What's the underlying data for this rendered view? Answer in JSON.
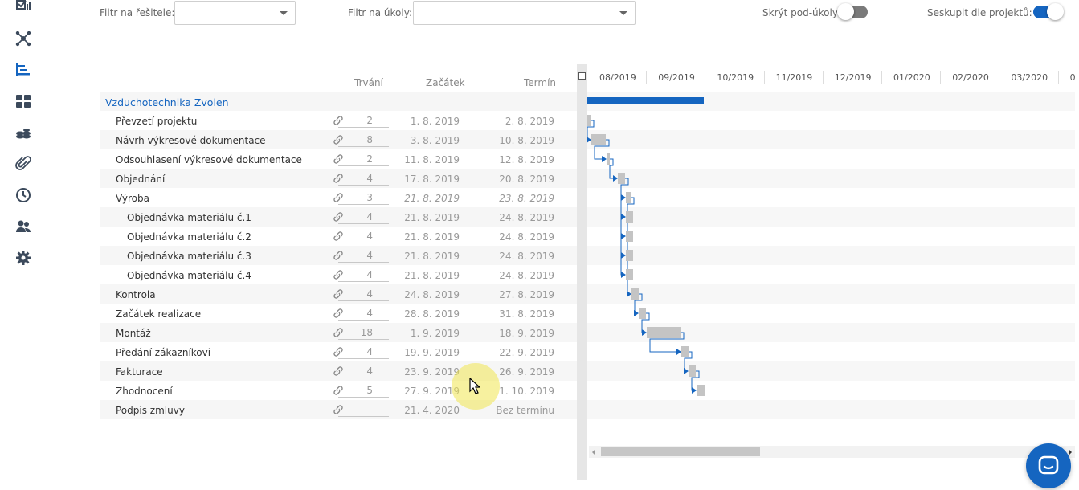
{
  "filters": {
    "assignee_label": "Filtr na řešitele:",
    "task_label": "Filtr na úkoly:",
    "hide_subtasks_label": "Skrýt pod-úkoly:",
    "hide_subtasks_on": false,
    "group_by_project_label": "Seskupit dle projektů:",
    "group_by_project_on": true
  },
  "table": {
    "headers": {
      "duration": "Trvání",
      "start": "Začátek",
      "end": "Termín"
    },
    "rows": [
      {
        "name": "Vzduchotechnika Zvolen",
        "type": "project",
        "duration": "",
        "start": "",
        "end": ""
      },
      {
        "name": "Převzetí projektu",
        "type": "task",
        "duration": "2",
        "start": "1. 8. 2019",
        "end": "2. 8. 2019"
      },
      {
        "name": "Návrh výkresové dokumentace",
        "type": "task",
        "duration": "8",
        "start": "3. 8. 2019",
        "end": "10. 8. 2019"
      },
      {
        "name": "Odsouhlasení výkresové dokumentace",
        "type": "task",
        "duration": "2",
        "start": "11. 8. 2019",
        "end": "12. 8. 2019"
      },
      {
        "name": "Objednání",
        "type": "task",
        "duration": "4",
        "start": "17. 8. 2019",
        "end": "20. 8. 2019"
      },
      {
        "name": "Výroba",
        "type": "parent",
        "duration": "3",
        "start": "21. 8. 2019",
        "end": "23. 8. 2019"
      },
      {
        "name": "Objednávka materiálu č.1",
        "type": "subtask",
        "duration": "4",
        "start": "21. 8. 2019",
        "end": "24. 8. 2019"
      },
      {
        "name": "Objednávka materiálu č.2",
        "type": "subtask",
        "duration": "4",
        "start": "21. 8. 2019",
        "end": "24. 8. 2019"
      },
      {
        "name": "Objednávka materiálu č.3",
        "type": "subtask",
        "duration": "4",
        "start": "21. 8. 2019",
        "end": "24. 8. 2019"
      },
      {
        "name": "Objednávka materiálu č.4",
        "type": "subtask",
        "duration": "4",
        "start": "21. 8. 2019",
        "end": "24. 8. 2019"
      },
      {
        "name": "Kontrola",
        "type": "task",
        "duration": "4",
        "start": "24. 8. 2019",
        "end": "27. 8. 2019"
      },
      {
        "name": "Začátek realizace",
        "type": "task",
        "duration": "4",
        "start": "28. 8. 2019",
        "end": "31. 8. 2019"
      },
      {
        "name": "Montáž",
        "type": "task",
        "duration": "18",
        "start": "1. 9. 2019",
        "end": "18. 9. 2019"
      },
      {
        "name": "Předání zákazníkovi",
        "type": "task",
        "duration": "4",
        "start": "19. 9. 2019",
        "end": "22. 9. 2019"
      },
      {
        "name": "Fakturace",
        "type": "task",
        "duration": "4",
        "start": "23. 9. 2019",
        "end": "26. 9. 2019"
      },
      {
        "name": "Zhodnocení",
        "type": "task",
        "duration": "5",
        "start": "27. 9. 2019",
        "end": "1. 10. 2019"
      },
      {
        "name": "Podpis zmluvy",
        "type": "task",
        "duration": "",
        "start": "21. 4. 2020",
        "end": "Bez termínu"
      }
    ]
  },
  "timeline": {
    "months": [
      "08/2019",
      "09/2019",
      "10/2019",
      "11/2019",
      "12/2019",
      "01/2020",
      "02/2020",
      "03/2020",
      "0"
    ],
    "project_start": "2019-08-01",
    "bars": [
      {
        "start": "2019-08-01",
        "end": "2019-09-30"
      },
      {
        "start": "2019-08-01",
        "end": "2019-08-02"
      },
      {
        "start": "2019-08-03",
        "end": "2019-08-10"
      },
      {
        "start": "2019-08-11",
        "end": "2019-08-12"
      },
      {
        "start": "2019-08-17",
        "end": "2019-08-20"
      },
      {
        "start": "2019-08-21",
        "end": "2019-08-23"
      },
      {
        "start": "2019-08-21",
        "end": "2019-08-24"
      },
      {
        "start": "2019-08-21",
        "end": "2019-08-24"
      },
      {
        "start": "2019-08-21",
        "end": "2019-08-24"
      },
      {
        "start": "2019-08-21",
        "end": "2019-08-24"
      },
      {
        "start": "2019-08-24",
        "end": "2019-08-27"
      },
      {
        "start": "2019-08-28",
        "end": "2019-08-31"
      },
      {
        "start": "2019-09-01",
        "end": "2019-09-18"
      },
      {
        "start": "2019-09-19",
        "end": "2019-09-22"
      },
      {
        "start": "2019-09-23",
        "end": "2019-09-26"
      },
      {
        "start": "2019-09-27",
        "end": "2019-10-01"
      }
    ],
    "dependencies": [
      [
        1,
        2
      ],
      [
        2,
        3
      ],
      [
        3,
        4
      ],
      [
        4,
        5
      ],
      [
        4,
        6
      ],
      [
        4,
        7
      ],
      [
        4,
        8
      ],
      [
        4,
        9
      ],
      [
        5,
        10
      ],
      [
        10,
        11
      ],
      [
        11,
        12
      ],
      [
        12,
        13
      ],
      [
        13,
        14
      ],
      [
        14,
        15
      ]
    ]
  },
  "icons": {
    "rail": [
      "tasks-check-icon",
      "network-icon",
      "gantt-icon",
      "dashboard-icon",
      "budget-icon",
      "attachment-icon",
      "clock-icon",
      "users-icon",
      "settings-icon"
    ],
    "chat": "chat-icon"
  },
  "colors": {
    "accent": "#1565c0",
    "bar": "#c4c4c4",
    "link": "#1565c0"
  }
}
